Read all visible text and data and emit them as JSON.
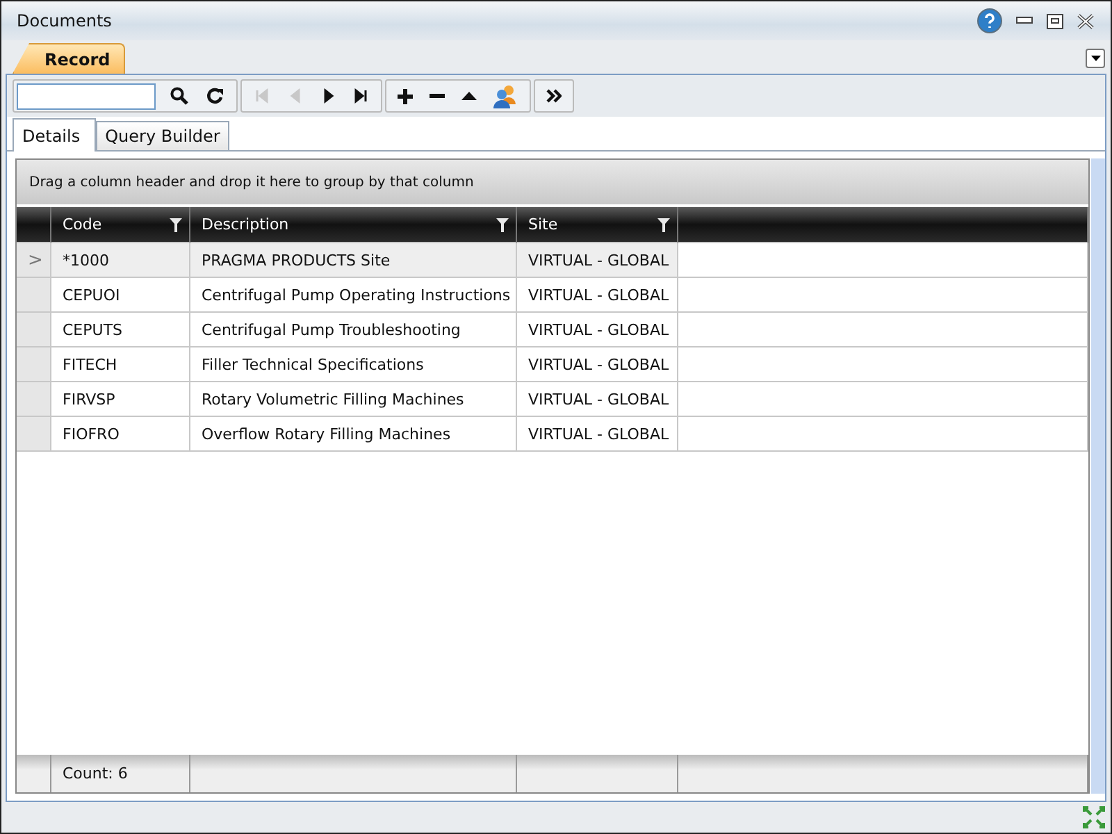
{
  "window": {
    "title": "Documents"
  },
  "top_tabs": [
    {
      "label": "Record",
      "selected": true
    }
  ],
  "toolbar": {
    "nav": [
      {
        "kind": "first",
        "disabled": true
      },
      {
        "kind": "prev",
        "disabled": true
      },
      {
        "kind": "next",
        "disabled": false
      },
      {
        "kind": "last",
        "disabled": false
      }
    ]
  },
  "tabs": [
    {
      "label": "Details",
      "selected": true
    },
    {
      "label": "Query Builder",
      "selected": false
    }
  ],
  "group_panel": "Drag a column header and drop it here to group by that column",
  "table": {
    "columns": [
      "Code",
      "Description",
      "Site"
    ],
    "rows": [
      {
        "cells": [
          "*1000",
          "PRAGMA PRODUCTS Site",
          "VIRTUAL - GLOBAL"
        ],
        "selected": true,
        "indicator": ">"
      },
      {
        "cells": [
          "CEPUOI",
          "Centrifugal Pump Operating Instructions",
          "VIRTUAL - GLOBAL"
        ],
        "selected": false
      },
      {
        "cells": [
          "CEPUTS",
          "Centrifugal Pump Troubleshooting",
          "VIRTUAL - GLOBAL"
        ],
        "selected": false
      },
      {
        "cells": [
          "FITECH",
          "Filler Technical Specifications",
          "VIRTUAL - GLOBAL"
        ],
        "selected": false
      },
      {
        "cells": [
          "FIRVSP",
          "Rotary Volumetric Filling Machines",
          "VIRTUAL - GLOBAL"
        ],
        "selected": false
      },
      {
        "cells": [
          "FIOFRO",
          "Overflow Rotary Filling Machines",
          "VIRTUAL - GLOBAL"
        ],
        "selected": false
      }
    ],
    "footer": "Count: 6"
  }
}
